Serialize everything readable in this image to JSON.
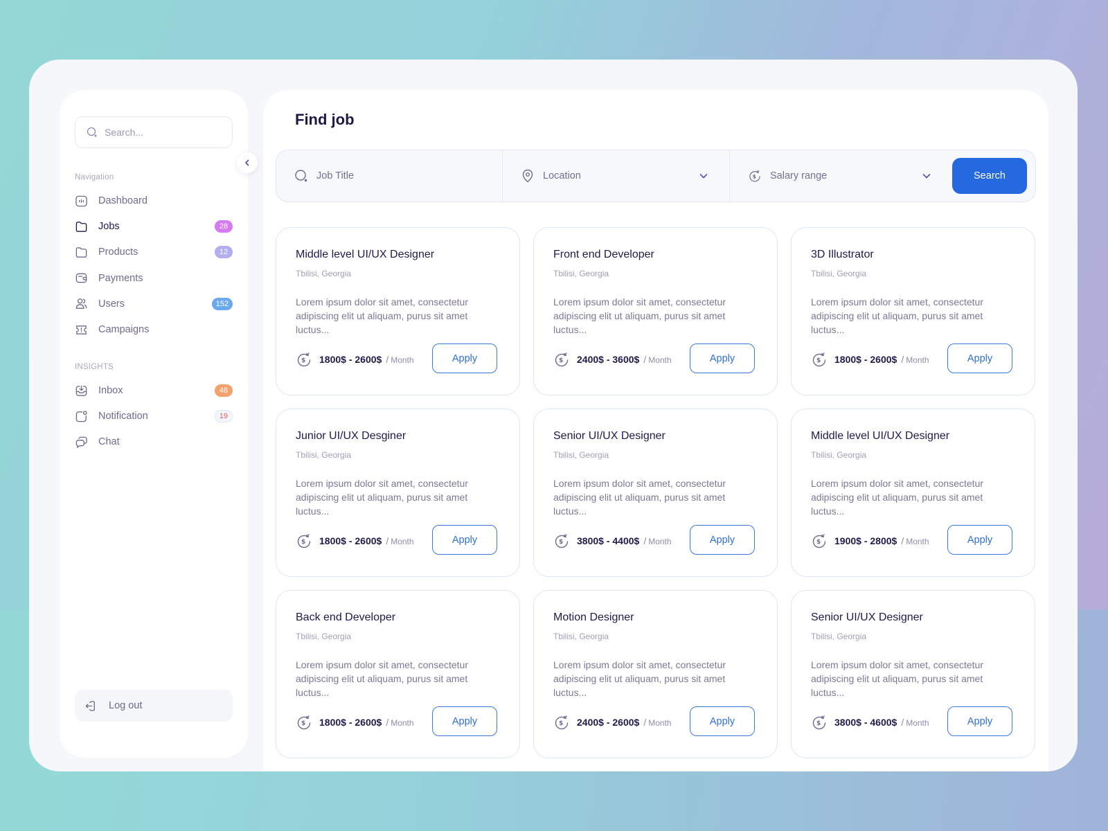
{
  "sidebar": {
    "search_placeholder": "Search...",
    "nav_label": "Navigation",
    "nav_items": [
      {
        "label": "Dashboard",
        "icon": "dashboard-icon",
        "badge": null
      },
      {
        "label": "Jobs",
        "icon": "folder-icon",
        "badge": "28",
        "badge_color": "#d57af0",
        "active": true
      },
      {
        "label": "Products",
        "icon": "folder-icon",
        "badge": "12",
        "badge_color": "#b3aef0"
      },
      {
        "label": "Payments",
        "icon": "wallet-icon",
        "badge": null
      },
      {
        "label": "Users",
        "icon": "users-icon",
        "badge": "152",
        "badge_color": "#6aa8f0"
      },
      {
        "label": "Campaigns",
        "icon": "ticket-icon",
        "badge": null
      }
    ],
    "insights_label": "INSIGHTS",
    "insight_items": [
      {
        "label": "Inbox",
        "icon": "inbox-icon",
        "badge": "48",
        "badge_color": "#f4a16e"
      },
      {
        "label": "Notification",
        "icon": "notification-icon",
        "badge": "19",
        "badge_color": "#e55a5a"
      },
      {
        "label": "Chat",
        "icon": "chat-icon",
        "badge": null
      }
    ],
    "logout_label": "Log out"
  },
  "main": {
    "title": "Find job",
    "filters": {
      "job_title_placeholder": "Job Title",
      "location_placeholder": "Location",
      "salary_placeholder": "Salary range",
      "search_label": "Search"
    },
    "jobs": [
      {
        "title": "Middle level UI/UX Designer",
        "location": "Tbilisi, Georgia",
        "description": "Lorem ipsum dolor sit amet, consectetur adipiscing elit ut aliquam, purus sit amet luctus...",
        "salary": "1800$ - 2600$",
        "period": "Month",
        "apply_label": "Apply"
      },
      {
        "title": "Front end Developer",
        "location": "Tbilisi, Georgia",
        "description": "Lorem ipsum dolor sit amet, consectetur adipiscing elit ut aliquam, purus sit amet luctus...",
        "salary": "2400$ - 3600$",
        "period": "Month",
        "apply_label": "Apply"
      },
      {
        "title": "3D Illustrator",
        "location": "Tbilisi, Georgia",
        "description": "Lorem ipsum dolor sit amet, consectetur adipiscing elit ut aliquam, purus sit amet luctus...",
        "salary": "1800$ - 2600$",
        "period": "Month",
        "apply_label": "Apply"
      },
      {
        "title": "Junior UI/UX Desginer",
        "location": "Tbilisi, Georgia",
        "description": "Lorem ipsum dolor sit amet, consectetur adipiscing elit ut aliquam, purus sit amet luctus...",
        "salary": "1800$ - 2600$",
        "period": "Month",
        "apply_label": "Apply"
      },
      {
        "title": "Senior UI/UX Designer",
        "location": "Tbilisi, Georgia",
        "description": "Lorem ipsum dolor sit amet, consectetur adipiscing elit ut aliquam, purus sit amet luctus...",
        "salary": "3800$ - 4400$",
        "period": "Month",
        "apply_label": "Apply"
      },
      {
        "title": "Middle level UI/UX Designer",
        "location": "Tbilisi, Georgia",
        "description": "Lorem ipsum dolor sit amet, consectetur adipiscing elit ut aliquam, purus sit amet luctus...",
        "salary": "1900$ - 2800$",
        "period": "Month",
        "apply_label": "Apply"
      },
      {
        "title": "Back end Developer",
        "location": "Tbilisi, Georgia",
        "description": "Lorem ipsum dolor sit amet, consectetur adipiscing elit ut aliquam, purus sit amet luctus...",
        "salary": "1800$ - 2600$",
        "period": "Month",
        "apply_label": "Apply"
      },
      {
        "title": "Motion Designer",
        "location": "Tbilisi, Georgia",
        "description": "Lorem ipsum dolor sit amet, consectetur adipiscing elit ut aliquam, purus sit amet luctus...",
        "salary": "2400$ - 2600$",
        "period": "Month",
        "apply_label": "Apply"
      },
      {
        "title": "Senior UI/UX Designer",
        "location": "Tbilisi, Georgia",
        "description": "Lorem ipsum dolor sit amet, consectetur adipiscing elit ut aliquam, purus sit amet luctus...",
        "salary": "3800$ - 4600$",
        "period": "Month",
        "apply_label": "Apply"
      }
    ]
  },
  "colors": {
    "accent": "#2469e0",
    "heading": "#1b1a47",
    "muted": "#736f93"
  }
}
